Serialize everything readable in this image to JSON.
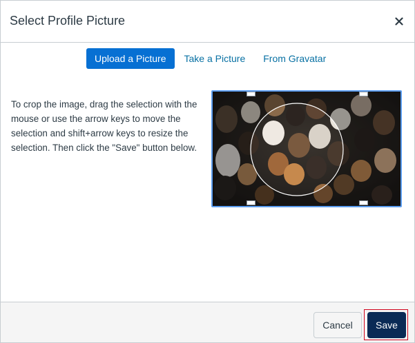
{
  "dialog": {
    "title": "Select Profile Picture",
    "close_icon": "close-icon"
  },
  "tabs": [
    {
      "label": "Upload a Picture",
      "active": true
    },
    {
      "label": "Take a Picture",
      "active": false
    },
    {
      "label": "From Gravatar",
      "active": false
    }
  ],
  "instructions": "To crop the image, drag the selection with the mouse or use the arrow keys to move the selection and shift+arrow keys to resize the selection. Then click the \"Save\" button below.",
  "footer": {
    "cancel_label": "Cancel",
    "save_label": "Save"
  },
  "colors": {
    "accent": "#0770d3",
    "link": "#0770a3",
    "save_button": "#0a2a55",
    "highlight_outline": "#d0021b",
    "crop_border": "#5b9df0"
  }
}
